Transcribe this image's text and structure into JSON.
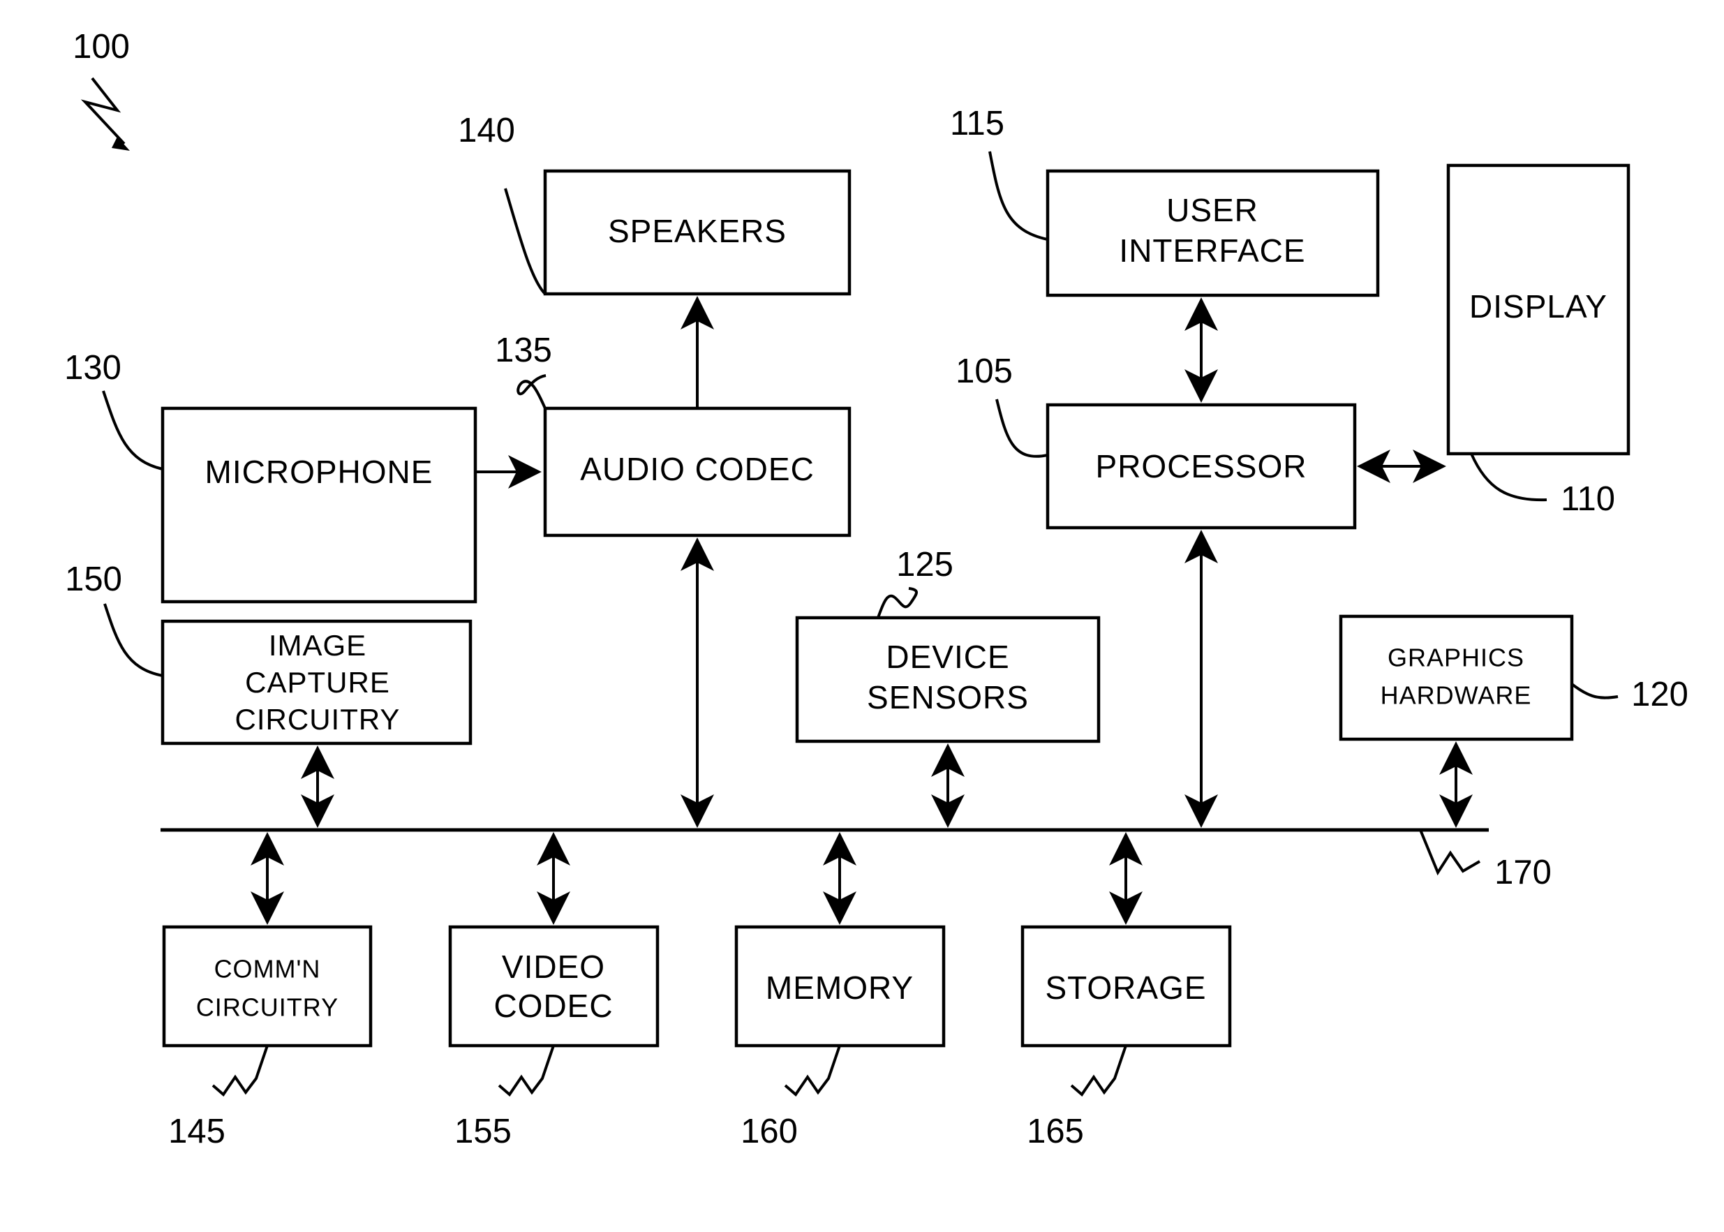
{
  "figure": {
    "figure_ref": "100",
    "bus_ref": "170",
    "blocks": [
      {
        "id": "speakers",
        "label_lines": [
          "SPEAKERS"
        ],
        "ref": "140"
      },
      {
        "id": "user-interface",
        "label_lines": [
          "USER",
          "INTERFACE"
        ],
        "ref": "115"
      },
      {
        "id": "display",
        "label_lines": [
          "DISPLAY"
        ],
        "ref": "110"
      },
      {
        "id": "microphone",
        "label_lines": [
          "MICROPHONE"
        ],
        "ref": "130"
      },
      {
        "id": "audio-codec",
        "label_lines": [
          "AUDIO CODEC"
        ],
        "ref": "135"
      },
      {
        "id": "processor",
        "label_lines": [
          "PROCESSOR"
        ],
        "ref": "105"
      },
      {
        "id": "image-capture",
        "label_lines": [
          "IMAGE",
          "CAPTURE",
          "CIRCUITRY"
        ],
        "ref": "150"
      },
      {
        "id": "device-sensors",
        "label_lines": [
          "DEVICE",
          "SENSORS"
        ],
        "ref": "125"
      },
      {
        "id": "graphics-hardware",
        "label_lines": [
          "GRAPHICS",
          "HARDWARE"
        ],
        "ref": "120"
      },
      {
        "id": "comm-circuitry",
        "label_lines": [
          "COMM'N",
          "CIRCUITRY"
        ],
        "ref": "145"
      },
      {
        "id": "video-codec",
        "label_lines": [
          "VIDEO",
          "CODEC"
        ],
        "ref": "155"
      },
      {
        "id": "memory",
        "label_lines": [
          "MEMORY"
        ],
        "ref": "160"
      },
      {
        "id": "storage",
        "label_lines": [
          "STORAGE"
        ],
        "ref": "165"
      }
    ],
    "text": {
      "speakers": "SPEAKERS",
      "user_interface_1": "USER",
      "user_interface_2": "INTERFACE",
      "display": "DISPLAY",
      "microphone": "MICROPHONE",
      "audio_codec": "AUDIO CODEC",
      "processor": "PROCESSOR",
      "image_capture_1": "IMAGE",
      "image_capture_2": "CAPTURE",
      "image_capture_3": "CIRCUITRY",
      "device_sensors_1": "DEVICE",
      "device_sensors_2": "SENSORS",
      "graphics_hardware_1": "GRAPHICS",
      "graphics_hardware_2": "HARDWARE",
      "comm_circuitry_1": "COMM'N",
      "comm_circuitry_2": "CIRCUITRY",
      "video_codec_1": "VIDEO",
      "video_codec_2": "CODEC",
      "memory": "MEMORY",
      "storage": "STORAGE"
    },
    "refs": {
      "figure": "100",
      "processor": "105",
      "display": "110",
      "user_interface": "115",
      "graphics_hardware": "120",
      "device_sensors": "125",
      "microphone": "130",
      "audio_codec": "135",
      "speakers": "140",
      "comm_circuitry": "145",
      "image_capture": "150",
      "video_codec": "155",
      "memory": "160",
      "storage": "165",
      "bus": "170"
    },
    "colors": {
      "stroke": "#000000",
      "background": "#ffffff"
    }
  }
}
